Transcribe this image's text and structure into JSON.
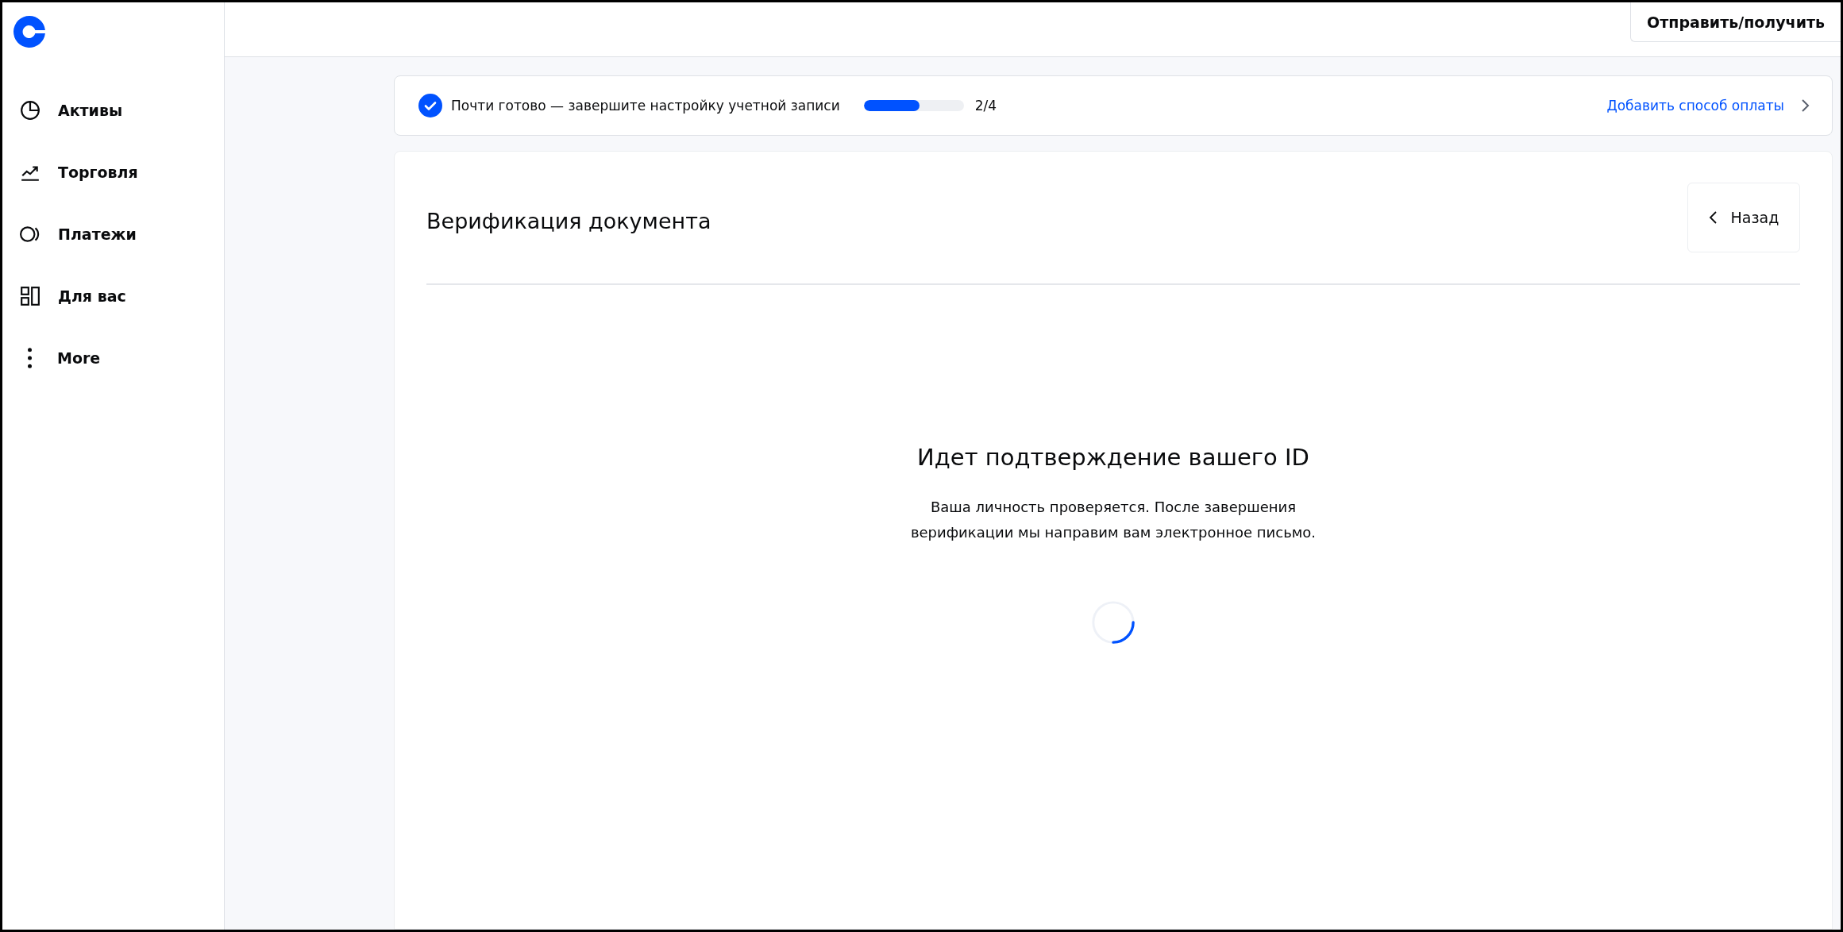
{
  "sidebar": {
    "items": [
      {
        "label": "Активы"
      },
      {
        "label": "Торговля"
      },
      {
        "label": "Платежи"
      },
      {
        "label": "Для вас"
      },
      {
        "label": "More"
      }
    ]
  },
  "top_bar": {
    "button": "Отправить/получить"
  },
  "setup_banner": {
    "text": "Почти готово — завершите настройку учетной записи",
    "level": 0.56,
    "progress": "2/4",
    "link": "Добавить способ оплаты"
  },
  "card": {
    "title": "Верификация документа",
    "back_button": "Назад",
    "heading": "Идет подтверждение вашего ID",
    "message": "Ваша личность проверяется. После завершения верификации мы направим вам электронное письмо."
  }
}
